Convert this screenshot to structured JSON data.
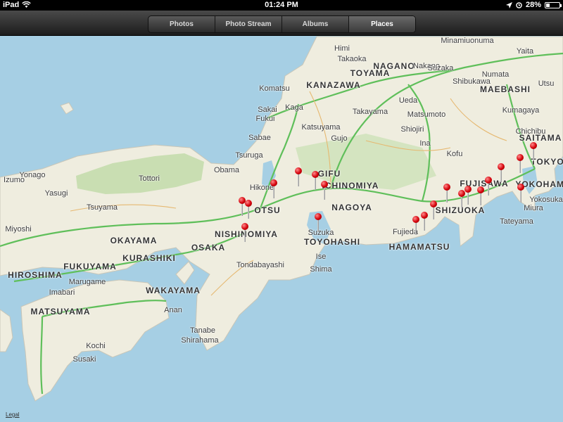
{
  "status": {
    "device": "iPad",
    "time": "01:24 PM",
    "battery": "28%",
    "battery_fraction": 0.28
  },
  "tabs": [
    {
      "label": "Photos",
      "active": false
    },
    {
      "label": "Photo Stream",
      "active": false
    },
    {
      "label": "Albums",
      "active": false
    },
    {
      "label": "Places",
      "active": true
    }
  ],
  "map": {
    "legal": "Legal",
    "colors": {
      "water": "#a6cfe4",
      "land": "#efeddf",
      "forest": "#c9deb2",
      "highway": "#5fbf5a"
    },
    "places": [
      {
        "name": "Minamiuonuma"
      },
      {
        "name": "Himi"
      },
      {
        "name": "Takaoka"
      },
      {
        "name": "NAGANO",
        "big": true
      },
      {
        "name": "Nakano"
      },
      {
        "name": "TOYAMA",
        "big": true
      },
      {
        "name": "Suzaka"
      },
      {
        "name": "Shibukawa"
      },
      {
        "name": "Numata"
      },
      {
        "name": "Yaita"
      },
      {
        "name": "Komatsu"
      },
      {
        "name": "KANAZAWA",
        "big": true
      },
      {
        "name": "MAEBASHI",
        "big": true
      },
      {
        "name": "Utsu"
      },
      {
        "name": "Kaga"
      },
      {
        "name": "Ueda"
      },
      {
        "name": "Sakai"
      },
      {
        "name": "Takayama"
      },
      {
        "name": "Matsumoto"
      },
      {
        "name": "Kumagaya"
      },
      {
        "name": "Fukui"
      },
      {
        "name": "Katsuyama"
      },
      {
        "name": "Shiojiri"
      },
      {
        "name": "Chichibu"
      },
      {
        "name": "Sabae"
      },
      {
        "name": "Gujo"
      },
      {
        "name": "Ina"
      },
      {
        "name": "SAITAMA",
        "big": true
      },
      {
        "name": "Tsuruga"
      },
      {
        "name": "Kofu"
      },
      {
        "name": "Obama"
      },
      {
        "name": "GIFU",
        "big": true
      },
      {
        "name": "TOKYO",
        "big": true
      },
      {
        "name": "Yonago"
      },
      {
        "name": "Tottori"
      },
      {
        "name": "Izumo"
      },
      {
        "name": "Yasugi"
      },
      {
        "name": "ICHINOMIYA",
        "big": true
      },
      {
        "name": "FUJISAWA",
        "big": true
      },
      {
        "name": "YOKOHAMA",
        "big": true
      },
      {
        "name": "Hikone"
      },
      {
        "name": "Tsuyama"
      },
      {
        "name": "OTSU",
        "big": true
      },
      {
        "name": "NAGOYA",
        "big": true
      },
      {
        "name": "Miyoshi"
      },
      {
        "name": "SHIZUOKA",
        "big": true
      },
      {
        "name": "Yokosuka"
      },
      {
        "name": "Miura"
      },
      {
        "name": "NISHINOMIYA",
        "big": true
      },
      {
        "name": "Suzuka"
      },
      {
        "name": "Fujieda"
      },
      {
        "name": "Tateyama"
      },
      {
        "name": "OKAYAMA",
        "big": true
      },
      {
        "name": "TOYOHASHI",
        "big": true
      },
      {
        "name": "HAMAMATSU",
        "big": true
      },
      {
        "name": "OSAKA",
        "big": true
      },
      {
        "name": "KURASHIKI",
        "big": true
      },
      {
        "name": "HIROSHIMA",
        "big": true
      },
      {
        "name": "FUKUYAMA",
        "big": true
      },
      {
        "name": "Ise"
      },
      {
        "name": "Tondabayashi"
      },
      {
        "name": "Shima"
      },
      {
        "name": "Marugame"
      },
      {
        "name": "Imabari"
      },
      {
        "name": "WAKAYAMA",
        "big": true
      },
      {
        "name": "MATSUYAMA",
        "big": true
      },
      {
        "name": "Anan"
      },
      {
        "name": "Tanabe"
      },
      {
        "name": "Shirahama"
      },
      {
        "name": "Kochi"
      },
      {
        "name": "Susaki"
      }
    ],
    "pin_count": 22
  }
}
